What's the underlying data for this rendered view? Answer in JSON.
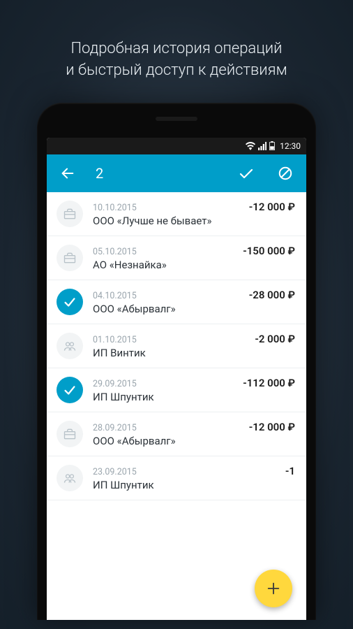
{
  "promo": {
    "line1": "Подробная история операций",
    "line2": "и быстрый доступ к действиям"
  },
  "status_bar": {
    "time": "12:30"
  },
  "app_bar": {
    "selected_count": "2"
  },
  "currency_symbol": "₽",
  "transactions": [
    {
      "date": "10.10.2015",
      "name": "ООО «Лучше не бывает»",
      "amount": "-12 000 ₽",
      "icon": "briefcase",
      "selected": false
    },
    {
      "date": "05.10.2015",
      "name": "АО «Незнайка»",
      "amount": "-150 000 ₽",
      "icon": "briefcase",
      "selected": false
    },
    {
      "date": "04.10.2015",
      "name": "ООО «Абырвалг»",
      "amount": "-28 000 ₽",
      "icon": "briefcase",
      "selected": true
    },
    {
      "date": "01.10.2015",
      "name": "ИП Винтик",
      "amount": "-2 000 ₽",
      "icon": "people",
      "selected": false
    },
    {
      "date": "29.09.2015",
      "name": "ИП Шпунтик",
      "amount": "-112 000 ₽",
      "icon": "briefcase",
      "selected": true
    },
    {
      "date": "28.09.2015",
      "name": "ООО «Абырвалг»",
      "amount": "-12 000 ₽",
      "icon": "briefcase",
      "selected": false
    },
    {
      "date": "23.09.2015",
      "name": "ИП Шпунтик",
      "amount": "-1",
      "icon": "people",
      "selected": false
    }
  ]
}
